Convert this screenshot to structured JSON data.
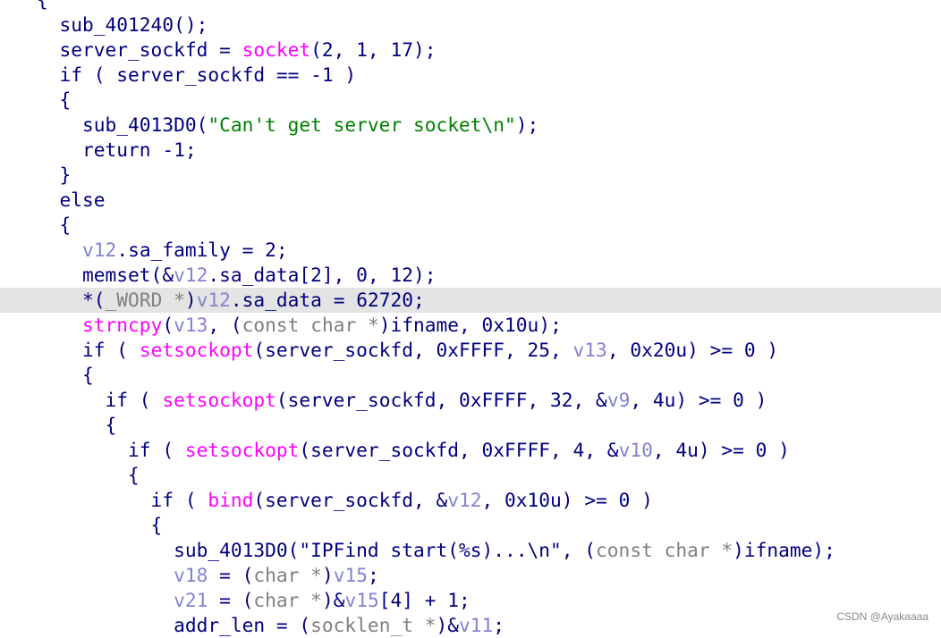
{
  "colors": {
    "plain": "#000080",
    "variable": "#8282d2",
    "function_call": "#ff00ff",
    "string": "#008000",
    "keyword_gray": "#808080",
    "highlight_line": "#e4e4e4",
    "background": "#ffffff"
  },
  "code_lines": [
    {
      "highlight": false,
      "tokens": [
        {
          "c": "p",
          "t": "{"
        }
      ]
    },
    {
      "highlight": false,
      "tokens": [
        {
          "c": "p",
          "t": "  sub_401240();"
        }
      ]
    },
    {
      "highlight": false,
      "tokens": [
        {
          "c": "p",
          "t": "  server_sockfd = "
        },
        {
          "c": "f",
          "t": "socket"
        },
        {
          "c": "p",
          "t": "(2, 1, 17);"
        }
      ]
    },
    {
      "highlight": false,
      "tokens": [
        {
          "c": "p",
          "t": "  if ( server_sockfd == -1 )"
        }
      ]
    },
    {
      "highlight": false,
      "tokens": [
        {
          "c": "p",
          "t": "  {"
        }
      ]
    },
    {
      "highlight": false,
      "tokens": [
        {
          "c": "p",
          "t": "    sub_4013D0("
        },
        {
          "c": "s",
          "t": "\"Can't get server socket\\n\""
        },
        {
          "c": "p",
          "t": ");"
        }
      ]
    },
    {
      "highlight": false,
      "tokens": [
        {
          "c": "p",
          "t": "    return -1;"
        }
      ]
    },
    {
      "highlight": false,
      "tokens": [
        {
          "c": "p",
          "t": "  }"
        }
      ]
    },
    {
      "highlight": false,
      "tokens": [
        {
          "c": "p",
          "t": "  else"
        }
      ]
    },
    {
      "highlight": false,
      "tokens": [
        {
          "c": "p",
          "t": "  {"
        }
      ]
    },
    {
      "highlight": false,
      "tokens": [
        {
          "c": "p",
          "t": "    "
        },
        {
          "c": "v",
          "t": "v12"
        },
        {
          "c": "p",
          "t": ".sa_family = 2;"
        }
      ]
    },
    {
      "highlight": false,
      "tokens": [
        {
          "c": "p",
          "t": "    memset(&"
        },
        {
          "c": "v",
          "t": "v12"
        },
        {
          "c": "p",
          "t": ".sa_data[2], 0, 12);"
        }
      ]
    },
    {
      "highlight": true,
      "tokens": [
        {
          "c": "p",
          "t": "    *("
        },
        {
          "c": "g",
          "t": "_WORD *"
        },
        {
          "c": "p",
          "t": ")"
        },
        {
          "c": "v",
          "t": "v12"
        },
        {
          "c": "p",
          "t": ".sa_data = 62720;"
        }
      ]
    },
    {
      "highlight": false,
      "tokens": [
        {
          "c": "p",
          "t": "    "
        },
        {
          "c": "f",
          "t": "strncpy"
        },
        {
          "c": "p",
          "t": "("
        },
        {
          "c": "v",
          "t": "v13"
        },
        {
          "c": "p",
          "t": ", ("
        },
        {
          "c": "g",
          "t": "const char *"
        },
        {
          "c": "p",
          "t": ")ifname, 0x10u);"
        }
      ]
    },
    {
      "highlight": false,
      "tokens": [
        {
          "c": "p",
          "t": "    if ( "
        },
        {
          "c": "f",
          "t": "setsockopt"
        },
        {
          "c": "p",
          "t": "(server_sockfd, 0xFFFF, 25, "
        },
        {
          "c": "v",
          "t": "v13"
        },
        {
          "c": "p",
          "t": ", 0x20u) >= 0 )"
        }
      ]
    },
    {
      "highlight": false,
      "tokens": [
        {
          "c": "p",
          "t": "    {"
        }
      ]
    },
    {
      "highlight": false,
      "tokens": [
        {
          "c": "p",
          "t": "      if ( "
        },
        {
          "c": "f",
          "t": "setsockopt"
        },
        {
          "c": "p",
          "t": "(server_sockfd, 0xFFFF, 32, &"
        },
        {
          "c": "v",
          "t": "v9"
        },
        {
          "c": "p",
          "t": ", 4u) >= 0 )"
        }
      ]
    },
    {
      "highlight": false,
      "tokens": [
        {
          "c": "p",
          "t": "      {"
        }
      ]
    },
    {
      "highlight": false,
      "tokens": [
        {
          "c": "p",
          "t": "        if ( "
        },
        {
          "c": "f",
          "t": "setsockopt"
        },
        {
          "c": "p",
          "t": "(server_sockfd, 0xFFFF, 4, &"
        },
        {
          "c": "v",
          "t": "v10"
        },
        {
          "c": "p",
          "t": ", 4u) >= 0 )"
        }
      ]
    },
    {
      "highlight": false,
      "tokens": [
        {
          "c": "p",
          "t": "        {"
        }
      ]
    },
    {
      "highlight": false,
      "tokens": [
        {
          "c": "p",
          "t": "          if ( "
        },
        {
          "c": "f",
          "t": "bind"
        },
        {
          "c": "p",
          "t": "(server_sockfd, &"
        },
        {
          "c": "v",
          "t": "v12"
        },
        {
          "c": "p",
          "t": ", 0x10u) >= 0 )"
        }
      ]
    },
    {
      "highlight": false,
      "tokens": [
        {
          "c": "p",
          "t": "          {"
        }
      ]
    },
    {
      "highlight": false,
      "tokens": [
        {
          "c": "p",
          "t": "            sub_4013D0(\"IPFind start(%s)...\\n\", ("
        },
        {
          "c": "g",
          "t": "const char *"
        },
        {
          "c": "p",
          "t": ")ifname);"
        }
      ]
    },
    {
      "highlight": false,
      "tokens": [
        {
          "c": "p",
          "t": "            "
        },
        {
          "c": "v",
          "t": "v18"
        },
        {
          "c": "p",
          "t": " = ("
        },
        {
          "c": "g",
          "t": "char *"
        },
        {
          "c": "p",
          "t": ")"
        },
        {
          "c": "v",
          "t": "v15"
        },
        {
          "c": "p",
          "t": ";"
        }
      ]
    },
    {
      "highlight": false,
      "tokens": [
        {
          "c": "p",
          "t": "            "
        },
        {
          "c": "v",
          "t": "v21"
        },
        {
          "c": "p",
          "t": " = ("
        },
        {
          "c": "g",
          "t": "char *"
        },
        {
          "c": "p",
          "t": ")&"
        },
        {
          "c": "v",
          "t": "v15"
        },
        {
          "c": "p",
          "t": "[4] + 1;"
        }
      ]
    },
    {
      "highlight": false,
      "tokens": [
        {
          "c": "p",
          "t": "            addr_len = ("
        },
        {
          "c": "g",
          "t": "socklen_t *"
        },
        {
          "c": "p",
          "t": ")&"
        },
        {
          "c": "v",
          "t": "v11"
        },
        {
          "c": "p",
          "t": ";"
        }
      ]
    }
  ],
  "watermark": "CSDN @Ayakaaaa"
}
